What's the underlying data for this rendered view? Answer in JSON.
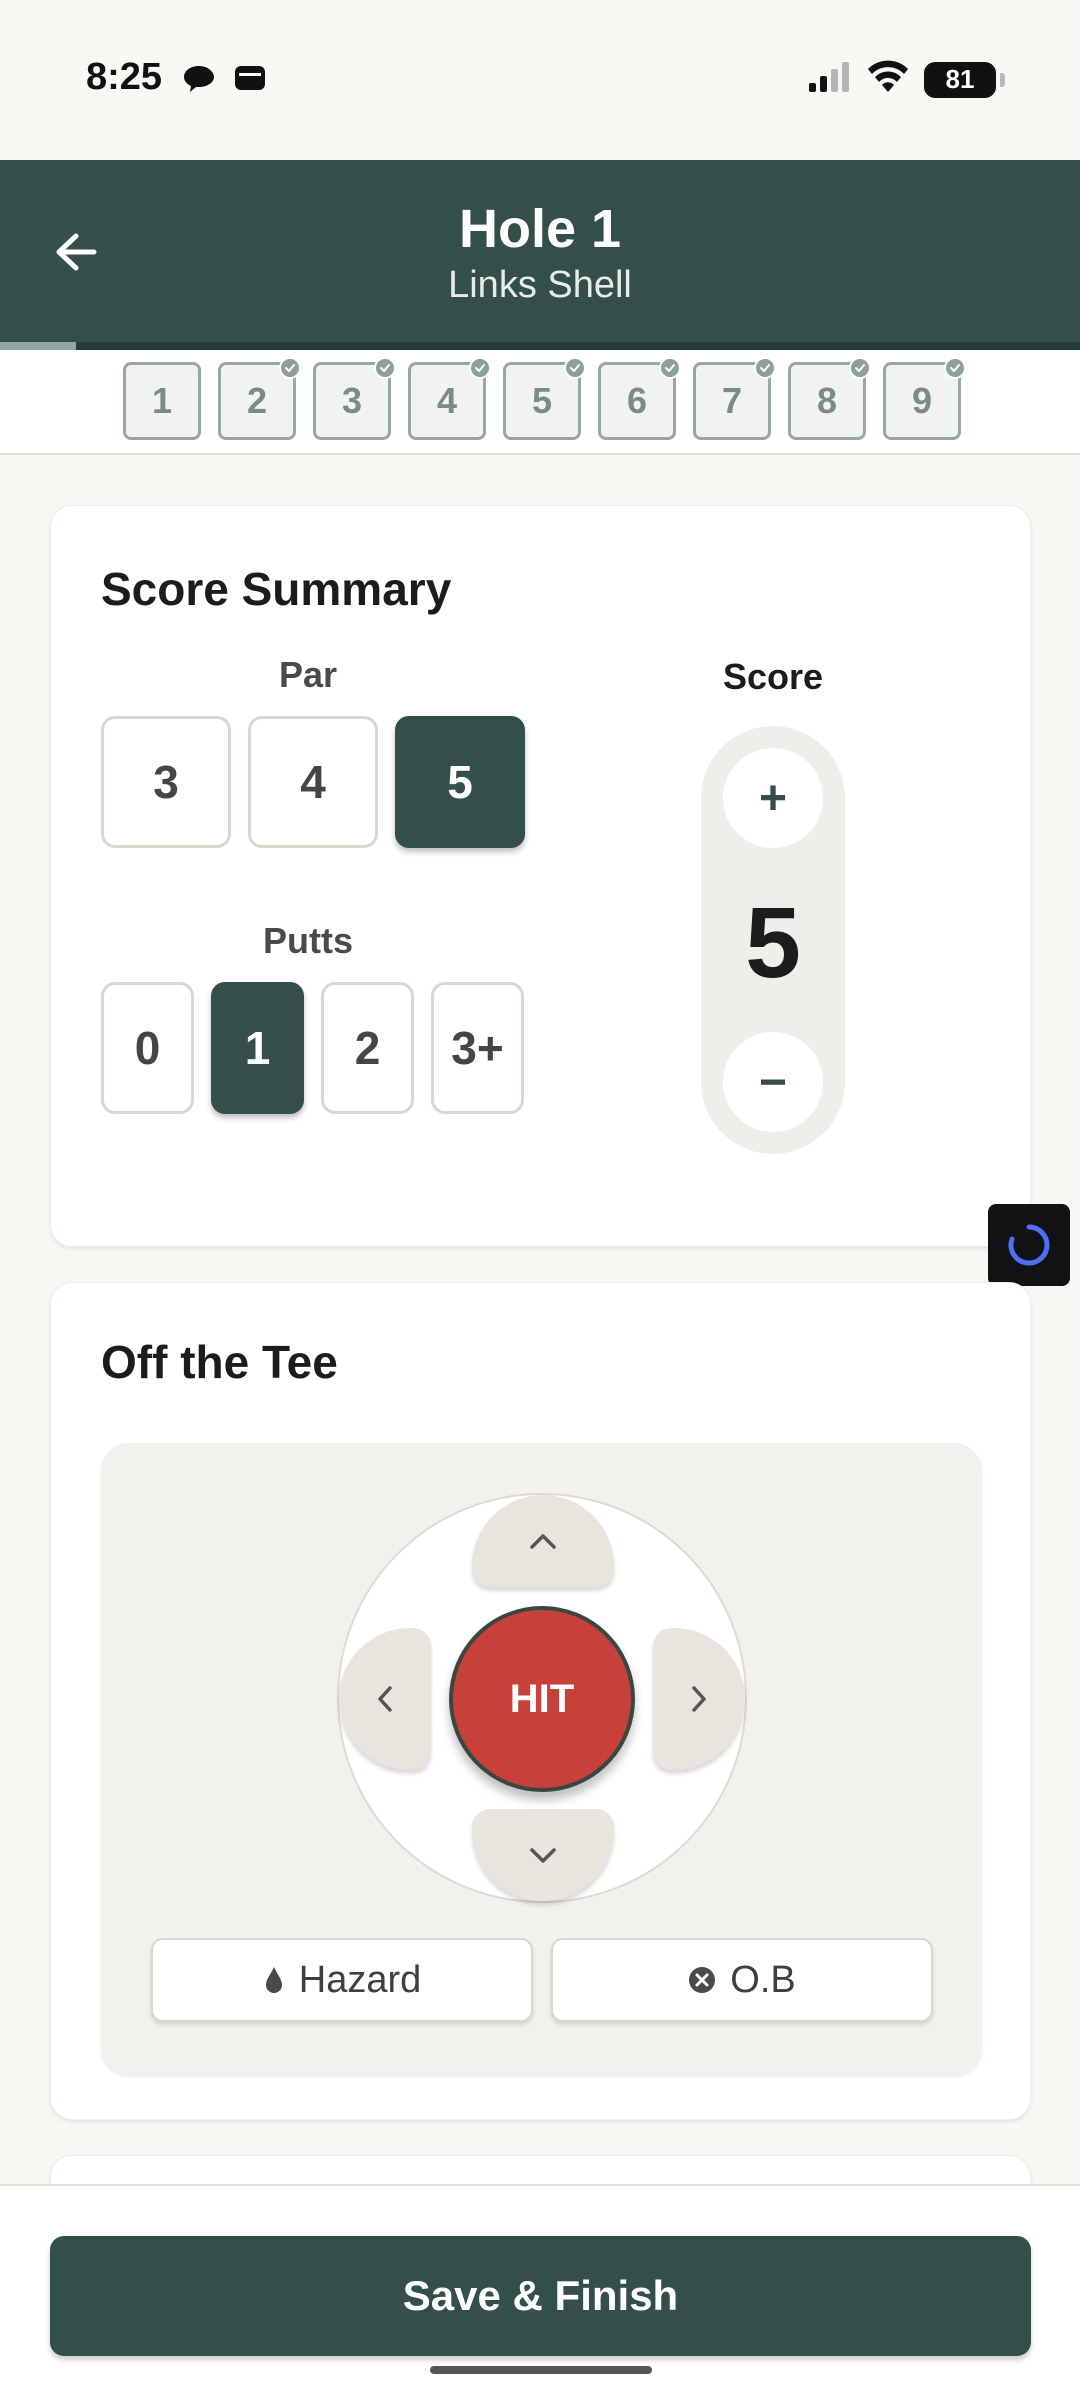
{
  "status_bar": {
    "time": "8:25",
    "battery": "81"
  },
  "header": {
    "title": "Hole 1",
    "subtitle": "Links Shell",
    "progress": 0.07
  },
  "holes": [
    {
      "label": "1",
      "done": false
    },
    {
      "label": "2",
      "done": true
    },
    {
      "label": "3",
      "done": true
    },
    {
      "label": "4",
      "done": true
    },
    {
      "label": "5",
      "done": true
    },
    {
      "label": "6",
      "done": true
    },
    {
      "label": "7",
      "done": true
    },
    {
      "label": "8",
      "done": true
    },
    {
      "label": "9",
      "done": true
    }
  ],
  "score_summary": {
    "title": "Score Summary",
    "par_label": "Par",
    "par_options": [
      "3",
      "4",
      "5"
    ],
    "par_selected": "5",
    "putts_label": "Putts",
    "putts_options": [
      "0",
      "1",
      "2",
      "3+"
    ],
    "putts_selected": "1",
    "score_label": "Score",
    "score_value": "5",
    "plus": "+",
    "minus": "−"
  },
  "off_the_tee": {
    "title": "Off the Tee",
    "hit_label": "HIT",
    "hazard_label": "Hazard",
    "ob_label": "O.B"
  },
  "footer": {
    "save_label": "Save & Finish"
  },
  "colors": {
    "primary": "#344e4a",
    "hit": "#c8403a",
    "background": "#f8f7f4"
  }
}
